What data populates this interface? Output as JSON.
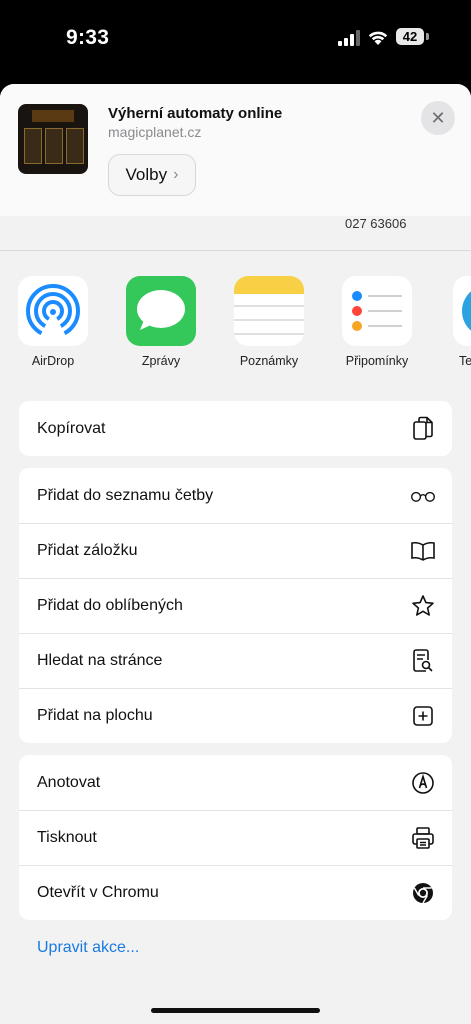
{
  "status": {
    "time": "9:33",
    "battery": "42"
  },
  "header": {
    "title": "Výherní automaty online",
    "url": "magicplanet.cz",
    "options_label": "Volby",
    "close_symbol": "✕",
    "background_text": "027 63606"
  },
  "apps": [
    {
      "label": "AirDrop",
      "icon": "airdrop-icon"
    },
    {
      "label": "Zprávy",
      "icon": "messages-icon"
    },
    {
      "label": "Poznámky",
      "icon": "notes-icon"
    },
    {
      "label": "Připomínky",
      "icon": "reminders-icon"
    },
    {
      "label": "Te",
      "icon": "telegram-icon"
    }
  ],
  "group1": [
    {
      "label": "Kopírovat",
      "icon": "copy-icon"
    }
  ],
  "group2": [
    {
      "label": "Přidat do seznamu četby",
      "icon": "glasses-icon"
    },
    {
      "label": "Přidat záložku",
      "icon": "book-icon"
    },
    {
      "label": "Přidat do oblíbených",
      "icon": "star-icon"
    },
    {
      "label": "Hledat na stránce",
      "icon": "find-page-icon"
    },
    {
      "label": "Přidat na plochu",
      "icon": "add-square-icon"
    }
  ],
  "group3": [
    {
      "label": "Anotovat",
      "icon": "markup-icon"
    },
    {
      "label": "Tisknout",
      "icon": "printer-icon"
    },
    {
      "label": "Otevřít v Chromu",
      "icon": "chrome-icon"
    }
  ],
  "edit_actions": "Upravit akce...",
  "colors": {
    "link": "#1a7ae0",
    "messages_green": "#34c759",
    "airdrop_blue": "#1a8cff",
    "notes_yellow": "#f7d046"
  }
}
